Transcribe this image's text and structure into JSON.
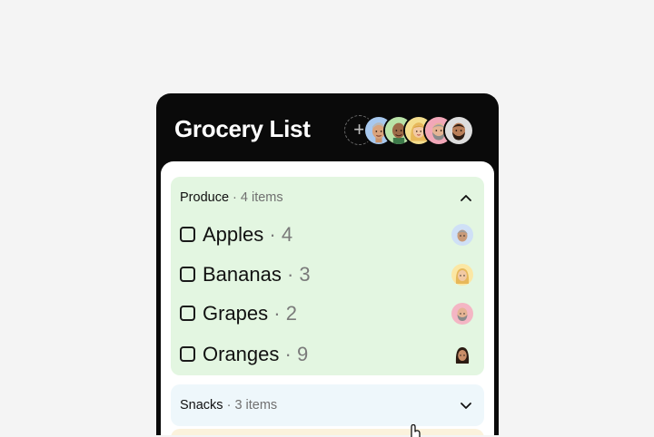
{
  "app": {
    "title": "Grocery List"
  },
  "header": {
    "add_symbol": "+",
    "collaborators": [
      {
        "icon": "avatar-gray-hair-man",
        "bg": "#a7c8ee"
      },
      {
        "icon": "avatar-bald-man",
        "bg": "#b9e3a8"
      },
      {
        "icon": "avatar-blonde-woman",
        "bg": "#f4de8e"
      },
      {
        "icon": "avatar-bearded-man",
        "bg": "#f2a7b8"
      },
      {
        "icon": "avatar-dark-beard-man",
        "bg": "#dddddd"
      }
    ]
  },
  "sections": [
    {
      "name": "Produce",
      "count_text": " · 4 items",
      "expanded": true,
      "color": "#e3f6e1",
      "items": [
        {
          "name": "Apples",
          "qty_text": " · 4",
          "checked": false,
          "avatar": "avatar-gray-hair-man"
        },
        {
          "name": "Bananas",
          "qty_text": " · 3",
          "checked": false,
          "avatar": "avatar-blonde-woman"
        },
        {
          "name": "Grapes",
          "qty_text": " · 2",
          "checked": false,
          "avatar": "avatar-bearded-man"
        },
        {
          "name": "Oranges",
          "qty_text": " · 9",
          "checked": false,
          "avatar": "avatar-dark-hair-woman"
        }
      ]
    },
    {
      "name": "Snacks",
      "count_text": " · 3 items",
      "expanded": false,
      "color": "#eef7fb"
    }
  ]
}
